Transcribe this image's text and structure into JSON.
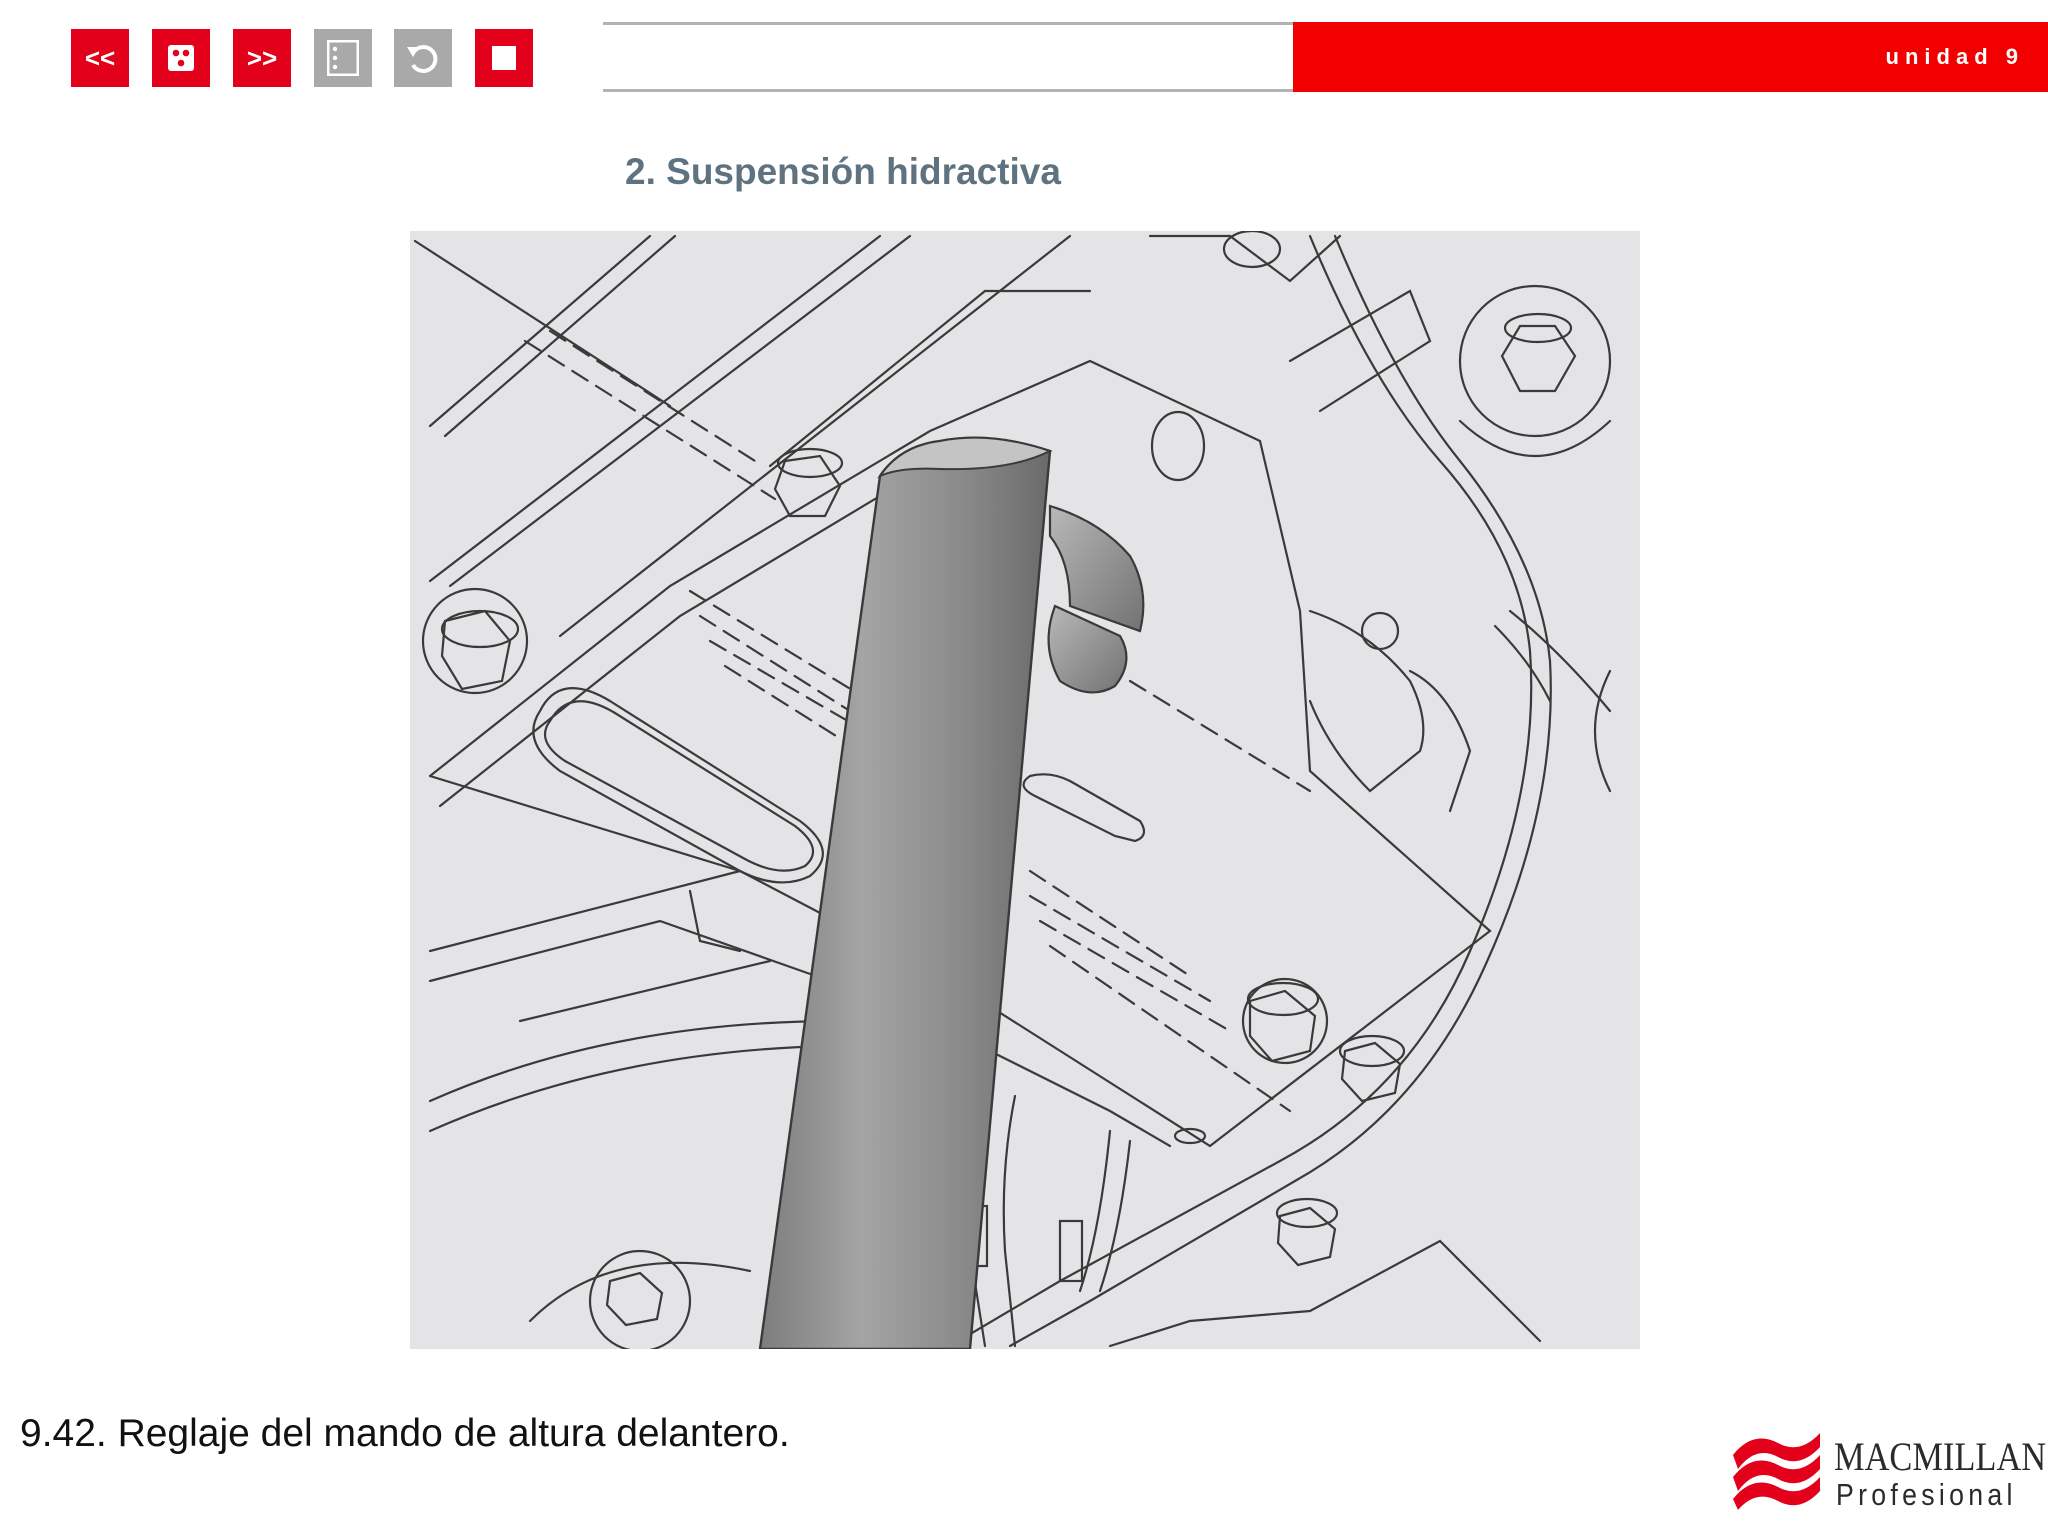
{
  "navigation": {
    "buttons": [
      {
        "name": "previous-button",
        "label": "<<",
        "icon": "double-chevron-left-icon"
      },
      {
        "name": "index-button",
        "label": "",
        "icon": "dice-icon"
      },
      {
        "name": "next-button",
        "label": ">>",
        "icon": "double-chevron-right-icon"
      },
      {
        "name": "contents-button",
        "label": "",
        "icon": "list-icon"
      },
      {
        "name": "back-button",
        "label": "",
        "icon": "undo-arrow-icon"
      },
      {
        "name": "exit-button",
        "label": "",
        "icon": "stop-square-icon"
      }
    ]
  },
  "header": {
    "unit_label": "unidad 9"
  },
  "section": {
    "title": "2. Suspensión hidractiva"
  },
  "figure": {
    "caption": "9.42. Reglaje del mando de altura delantero."
  },
  "brand": {
    "name": "MACMILLAN",
    "sub": "Profesional"
  },
  "colors": {
    "accent_red": "#e3001b",
    "header_red": "#f20000",
    "button_gray": "#a9a9a9",
    "title_slate": "#5f7280",
    "figure_bg": "#e4e4e6"
  }
}
